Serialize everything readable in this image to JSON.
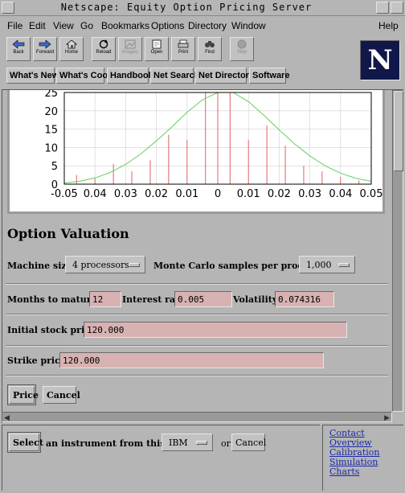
{
  "window": {
    "title": "Netscape: Equity Option Pricing Server"
  },
  "menu": [
    "File",
    "Edit",
    "View",
    "Go",
    "Bookmarks",
    "Options",
    "Directory",
    "Window",
    "Help"
  ],
  "toolbar": [
    "Back",
    "Forward",
    "Home",
    "Reload",
    "Images",
    "Open",
    "Print",
    "Find",
    "Stop"
  ],
  "directory_buttons": [
    "What's New",
    "What's Cool",
    "Handbook",
    "Net Search",
    "Net Directory",
    "Software"
  ],
  "logo": {
    "letter": "N"
  },
  "chart_data": {
    "type": "bar",
    "x_tick_labels": [
      "-0.05",
      "0.04",
      "0.03",
      "0.02",
      "0.01",
      "0",
      "0.01",
      "0.02",
      "0.03",
      "0.04",
      "0.05"
    ],
    "y_tick_labels": [
      "0",
      "5",
      "10",
      "15",
      "20",
      "25"
    ],
    "xlim": [
      -0.05,
      0.05
    ],
    "ylim": [
      0,
      25
    ],
    "grid": true,
    "bars": {
      "x": [
        -0.046,
        -0.04,
        -0.034,
        -0.028,
        -0.022,
        -0.016,
        -0.01,
        -0.004,
        0.0,
        0.004,
        0.01,
        0.016,
        0.022,
        0.028,
        0.034,
        0.04,
        0.046
      ],
      "values": [
        2.5,
        1.5,
        5.5,
        3.5,
        6.5,
        13.5,
        12.0,
        25.0,
        25.0,
        25.0,
        12.0,
        16.0,
        10.5,
        5.0,
        3.5,
        2.0,
        1.0
      ],
      "color": "#e06060"
    },
    "curve": {
      "x": [
        -0.05,
        -0.045,
        -0.04,
        -0.035,
        -0.03,
        -0.025,
        -0.02,
        -0.015,
        -0.01,
        -0.005,
        0.0,
        0.005,
        0.01,
        0.015,
        0.02,
        0.025,
        0.03,
        0.035,
        0.04,
        0.045,
        0.05
      ],
      "y": [
        0.3,
        0.8,
        1.7,
        3.2,
        5.4,
        8.3,
        11.8,
        15.6,
        19.6,
        23.0,
        25.0,
        25.0,
        22.5,
        18.8,
        14.8,
        11.0,
        7.7,
        5.0,
        3.0,
        1.6,
        0.8
      ],
      "color": "#60d060"
    }
  },
  "form": {
    "title": "Option Valuation",
    "machine_size_label": "Machine size:",
    "machine_size_value": "4 processors",
    "mc_label": "Monte Carlo samples per processor:",
    "mc_value": "1,000",
    "months_label": "Months to maturity:",
    "months_value": "12",
    "interest_label": "Interest rate:",
    "interest_value": "0.005",
    "volatility_label": "Volatility:",
    "volatility_value": "0.074316",
    "stock_label": "Initial stock prices:",
    "stock_value": "120.000",
    "strike_label": "Strike prices:",
    "strike_value": "120.000",
    "price_button": "Price",
    "cancel_button": "Cancel"
  },
  "lower": {
    "select_button": "Select",
    "instrument_text": "an instrument from this list",
    "instrument_value": "IBM",
    "or_text": "or",
    "cancel_button": "Cancel"
  },
  "nav_links": [
    "Contact",
    "Overview",
    "Calibration",
    "Simulation",
    "Charts"
  ]
}
